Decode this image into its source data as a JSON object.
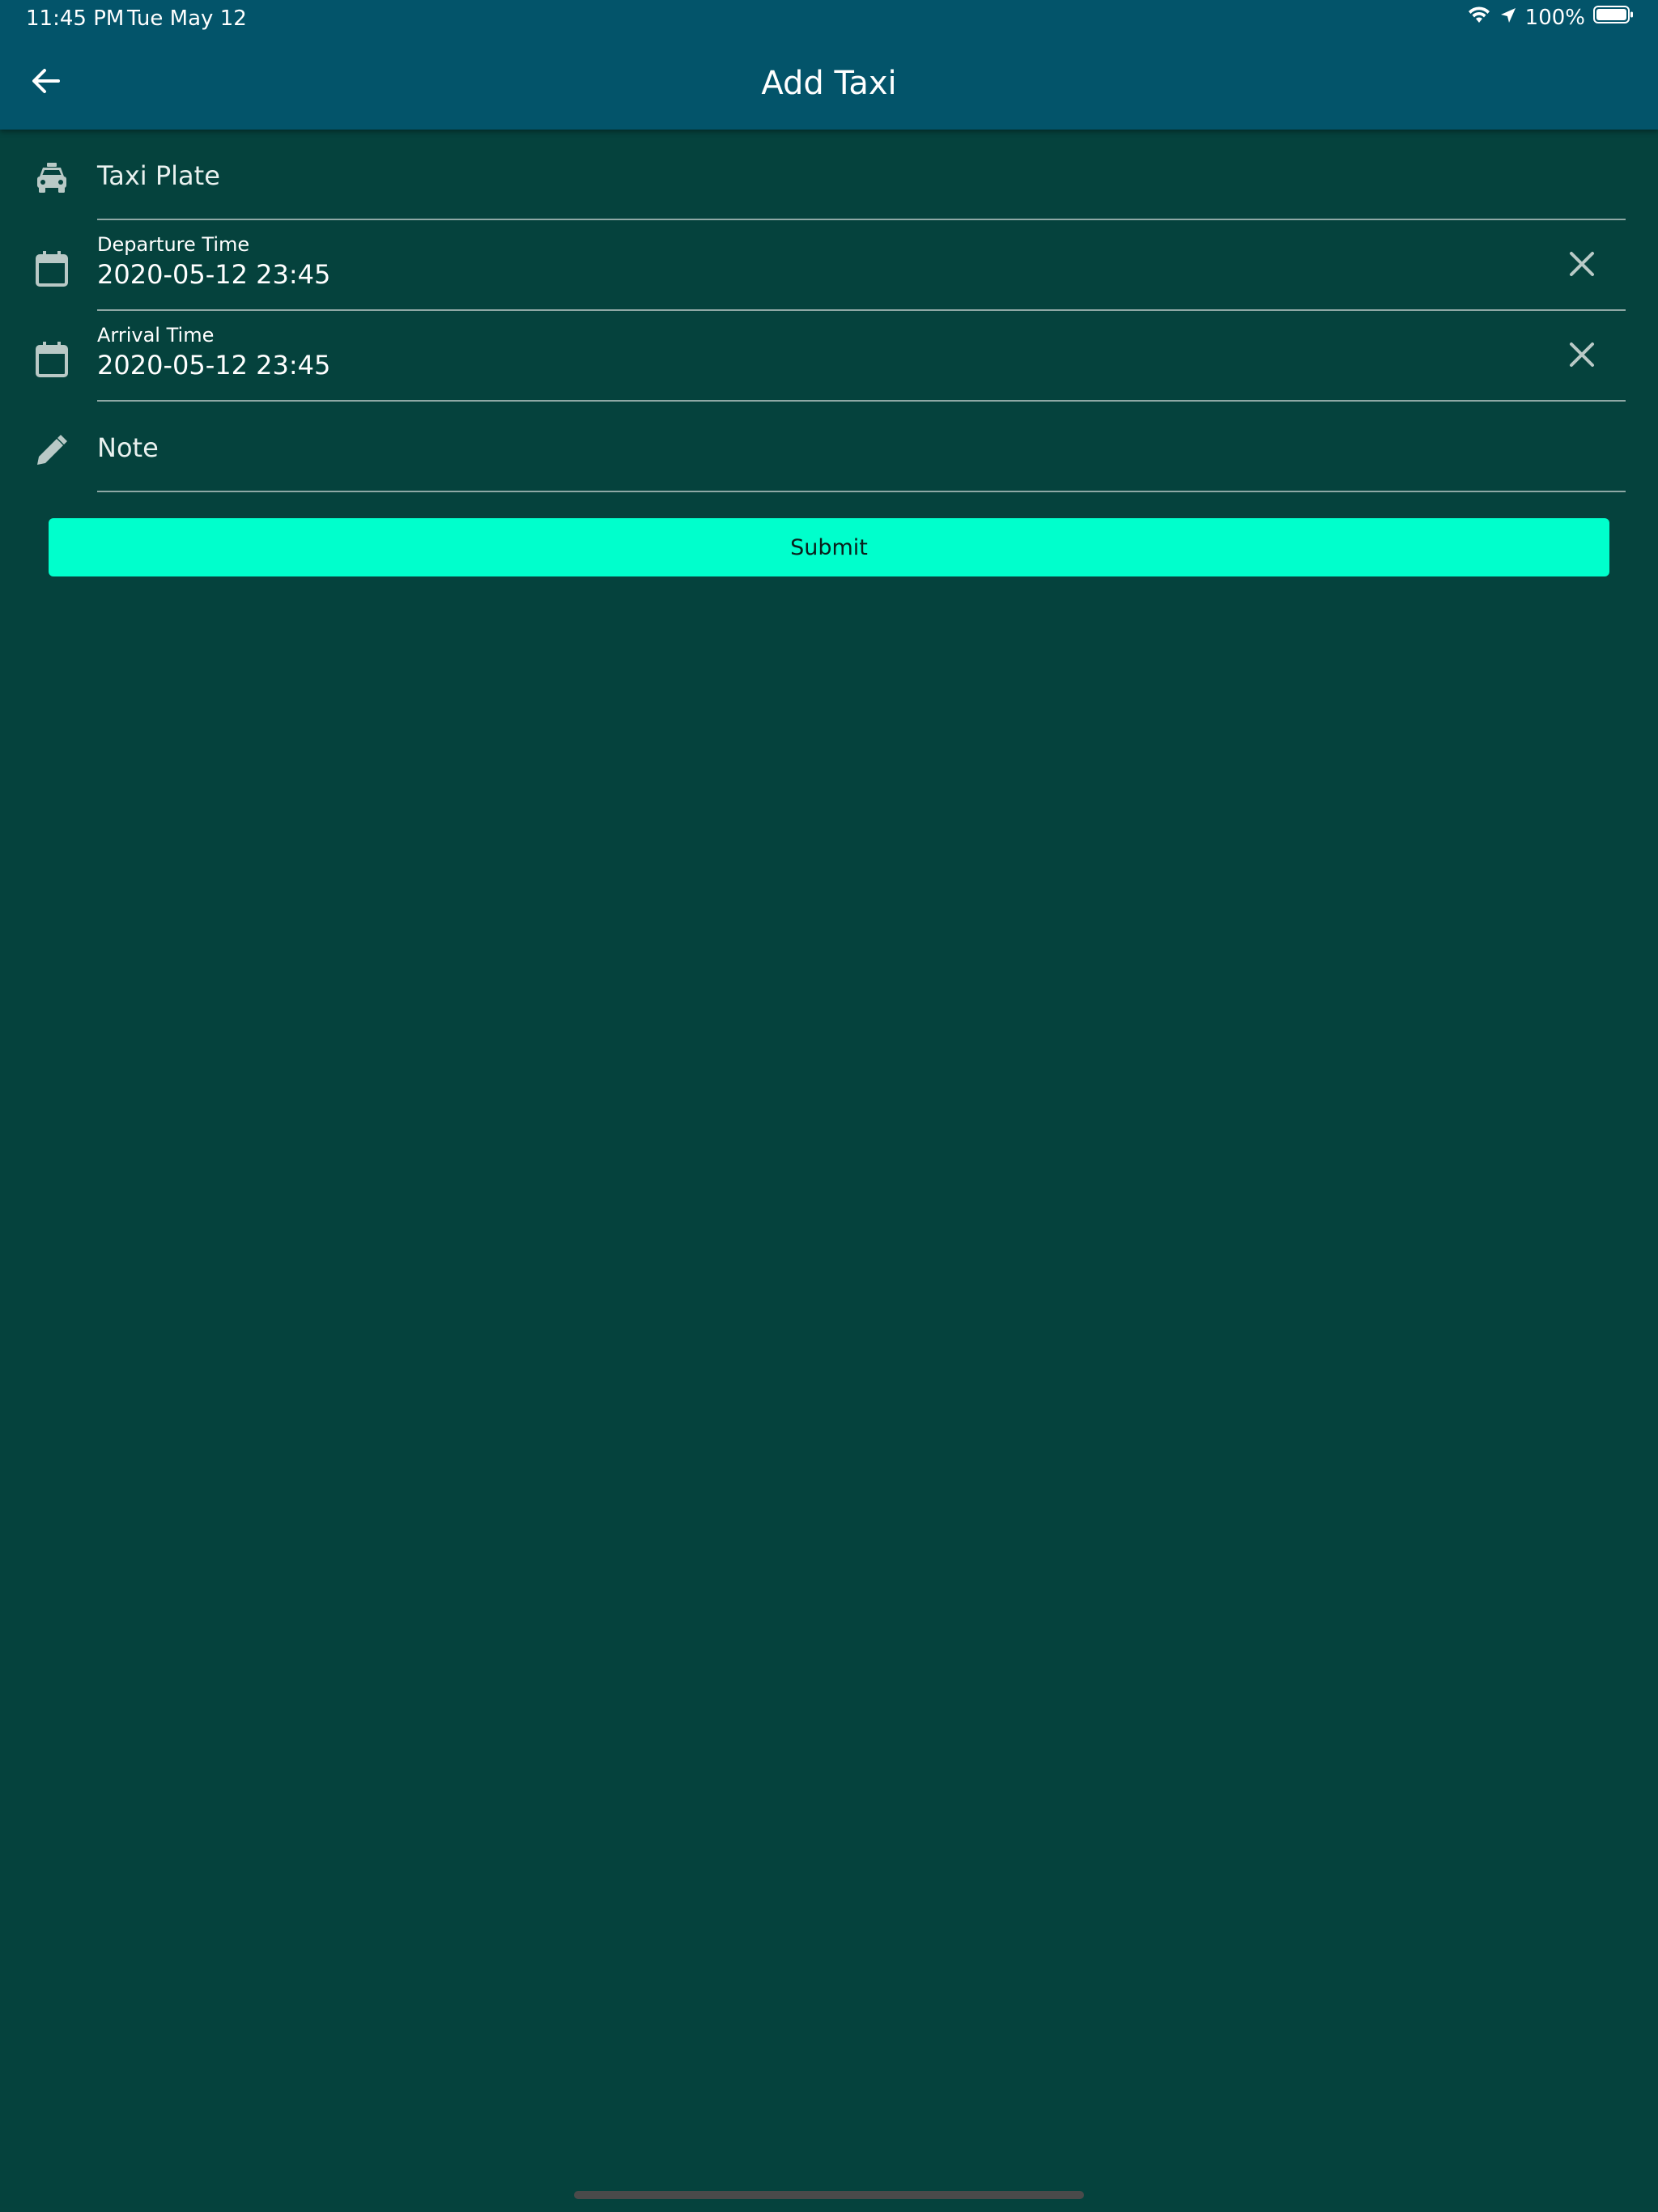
{
  "status_bar": {
    "time": "11:45 PM",
    "date": "Tue May 12",
    "battery": "100%",
    "icons": [
      "wifi-icon",
      "location-arrow-icon",
      "battery-icon"
    ]
  },
  "header": {
    "title": "Add Taxi",
    "back_icon": "arrow-left-icon"
  },
  "form": {
    "taxi_plate": {
      "placeholder": "Taxi Plate",
      "icon": "taxi-icon"
    },
    "departure": {
      "label": "Departure Time",
      "value": "2020-05-12 23:45",
      "icon": "calendar-icon",
      "clear_icon": "close-icon"
    },
    "arrival": {
      "label": "Arrival Time",
      "value": "2020-05-12 23:45",
      "icon": "calendar-icon",
      "clear_icon": "close-icon"
    },
    "note": {
      "placeholder": "Note",
      "icon": "pencil-icon"
    }
  },
  "submit_label": "Submit",
  "colors": {
    "header_bg": "#03546a",
    "page_bg": "#05423d",
    "accent": "#00ffcc",
    "icon": "#b9c9c6"
  }
}
